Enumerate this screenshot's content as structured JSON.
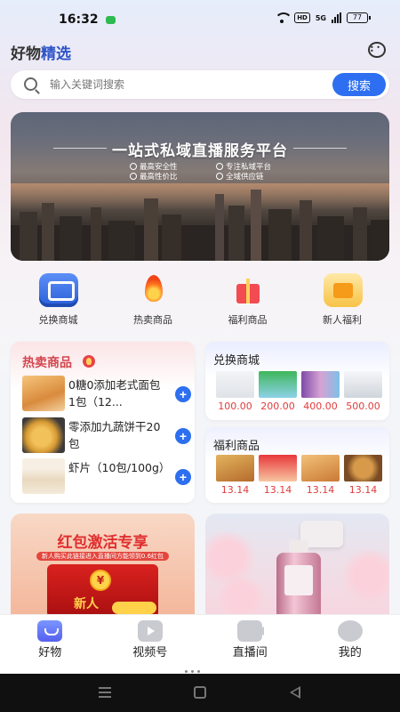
{
  "status_bar": {
    "time": "16:32",
    "hd": "HD",
    "network": "5G",
    "battery": "77"
  },
  "header": {
    "title_plain": "好物",
    "title_accent": "精选",
    "message_icon": "chat-bubble-icon"
  },
  "search": {
    "placeholder": "输入关键词搜索",
    "button": "搜索"
  },
  "banner": {
    "title": "一站式私域直播服务平台",
    "features": [
      "最高安全性",
      "专注私域平台",
      "最高性价比",
      "全域供应链"
    ]
  },
  "quick_nav": [
    {
      "label": "兑换商城",
      "icon": "exchange-store-icon"
    },
    {
      "label": "热卖商品",
      "icon": "fire-icon"
    },
    {
      "label": "福利商品",
      "icon": "gift-box-icon"
    },
    {
      "label": "新人福利",
      "icon": "treasure-chest-icon"
    }
  ],
  "hot_products": {
    "title": "热卖商品",
    "items": [
      {
        "name": "0糖0添加老式面包 1包（12..."
      },
      {
        "name": "零添加九蔬饼干20包"
      },
      {
        "name": "虾片（10包/100g）"
      }
    ]
  },
  "exchange_store": {
    "title": "兑换商城",
    "prices": [
      "100.00",
      "200.00",
      "400.00",
      "500.00"
    ]
  },
  "welfare_products": {
    "title": "福利商品",
    "prices": [
      "13.14",
      "13.14",
      "13.14",
      "13.14"
    ]
  },
  "promo_red": {
    "title": "红包激活专享",
    "subtitle": "新人购买此链接进入直播间方能领到0.6红包",
    "new_label": "新人",
    "coin": "¥"
  },
  "tab_bar": [
    {
      "label": "好物",
      "icon": "shopping-bag-icon",
      "active": true
    },
    {
      "label": "视频号",
      "icon": "video-icon",
      "active": false
    },
    {
      "label": "直播间",
      "icon": "live-camera-icon",
      "active": false
    },
    {
      "label": "我的",
      "icon": "user-icon",
      "active": false
    }
  ],
  "colors": {
    "accent": "#2d6ff0",
    "price": "#e03c3c",
    "hot": "#d4464e"
  }
}
